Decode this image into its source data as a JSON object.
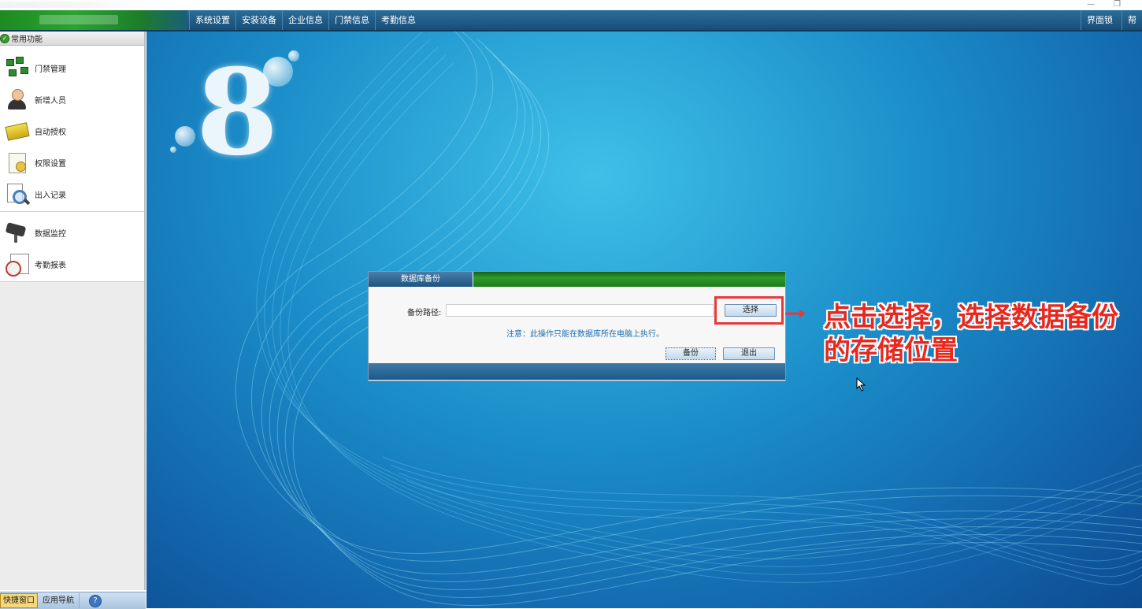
{
  "menubar": {
    "items": [
      "系统设置",
      "安装设备",
      "企业信息",
      "门禁信息",
      "考勤信息"
    ],
    "right_items": [
      "界面锁定",
      "帮"
    ]
  },
  "window_controls": {
    "minimize": "—",
    "restore": "❐"
  },
  "sidebar": {
    "header": "常用功能",
    "group1": [
      {
        "label": "门禁管理",
        "icon": "access-control-icon"
      },
      {
        "label": "新增人员",
        "icon": "user-icon"
      },
      {
        "label": "自动授权",
        "icon": "card-icon"
      },
      {
        "label": "权限设置",
        "icon": "certificate-icon"
      },
      {
        "label": "出入记录",
        "icon": "magnifier-icon"
      }
    ],
    "group2": [
      {
        "label": "数据监控",
        "icon": "camera-icon"
      },
      {
        "label": "考勤报表",
        "icon": "clock-report-icon"
      }
    ]
  },
  "bottom_tabs": {
    "quick_window": "快捷窗口",
    "app_nav": "应用导航",
    "help": "?"
  },
  "canvas": {
    "logo_text": "8"
  },
  "dialog": {
    "title": "数据库备份",
    "path_label": "备份路径:",
    "path_value": "",
    "choose_button": "选择",
    "notice": "注意：此操作只能在数据库所在电脑上执行。",
    "backup_button": "备份",
    "exit_button": "退出"
  },
  "annotation": {
    "text": "点击选择，选择数据备份的存储位置",
    "color": "#e8281e"
  }
}
